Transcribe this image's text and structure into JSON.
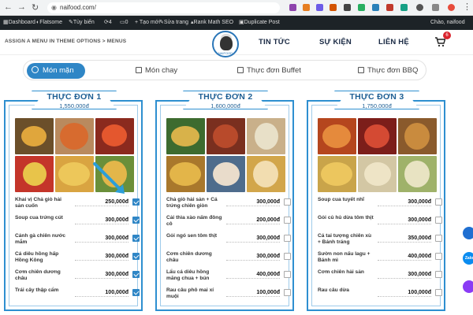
{
  "browser": {
    "url": "naifood.com/",
    "back_icon": "arrow-left-icon",
    "forward_icon": "arrow-right-icon",
    "reload_icon": "reload-icon"
  },
  "admin_bar": {
    "site": "Dashboard",
    "flatsome": "Flatsome",
    "customize": "Tùy biến",
    "updates": "4",
    "comments": "0",
    "new": "+ Tạo mới",
    "edit": "Sửa trang",
    "seo": "Rank Math SEO",
    "duplicate": "Duplicate Post",
    "greeting": "Chào, naifood"
  },
  "header": {
    "breadcrumb": "ASSIGN A MENU IN THEME OPTIONS > MENUS",
    "nav": [
      "TIN TỨC",
      "SỰ KIỆN",
      "LIÊN HỆ"
    ],
    "cart_count": "6",
    "logo_text": "NAIFOOD"
  },
  "tabs": [
    {
      "label": "Món mặn",
      "active": true
    },
    {
      "label": "Món chay",
      "active": false
    },
    {
      "label": "Thực đơn Buffet",
      "active": false
    },
    {
      "label": "Thực đơn BBQ",
      "active": false
    }
  ],
  "menus": [
    {
      "title": "THỰC ĐƠN 1",
      "price": "1,550,000đ",
      "items": [
        {
          "name": "Khai vị Chả giò hải sản cuốn",
          "price": "250,000đ",
          "checked": true
        },
        {
          "name": "Soup cua trứng cút",
          "price": "300,000đ",
          "checked": true
        },
        {
          "name": "Cánh gà chiên nước mắm",
          "price": "300,000đ",
          "checked": true
        },
        {
          "name": "Cá diêu hồng hấp Hồng Kông",
          "price": "300,000đ",
          "checked": true
        },
        {
          "name": "Cơm chiên dương châu",
          "price": "300,000đ",
          "checked": true
        },
        {
          "name": "Trái cây thập cẩm",
          "price": "100,000đ",
          "checked": true
        }
      ]
    },
    {
      "title": "THỰC ĐƠN 2",
      "price": "1,600,000đ",
      "items": [
        {
          "name": "Chả giò hải sản + Cá trứng chiên giòn",
          "price": "300,000đ",
          "checked": false
        },
        {
          "name": "Cải thìa xào nấm đông cô",
          "price": "200,000đ",
          "checked": false
        },
        {
          "name": "Gỏi ngó sen tôm thịt",
          "price": "300,000đ",
          "checked": false
        },
        {
          "name": "Cơm chiên dương châu",
          "price": "300,000đ",
          "checked": false
        },
        {
          "name": "Lẩu cá diêu hồng măng chua + bún",
          "price": "400,000đ",
          "checked": false
        },
        {
          "name": "Rau câu phô mai xí muội",
          "price": "100,000đ",
          "checked": false
        }
      ]
    },
    {
      "title": "THỰC ĐƠN 3",
      "price": "1,750,000đ",
      "items": [
        {
          "name": "Soup cua tuyết nhĩ",
          "price": "300,000đ",
          "checked": false
        },
        {
          "name": "Gỏi củ hủ dừa tôm thịt",
          "price": "300,000đ",
          "checked": false
        },
        {
          "name": "Cá tai tượng chiên xù + Bánh tráng",
          "price": "350,000đ",
          "checked": false
        },
        {
          "name": "Sườn non nấu lagu + Bánh mì",
          "price": "400,000đ",
          "checked": false
        },
        {
          "name": "Cơm chiên hải sản",
          "price": "300,000đ",
          "checked": false
        },
        {
          "name": "Rau câu dừa",
          "price": "100,000đ",
          "checked": false
        }
      ]
    }
  ],
  "float_buttons": [
    "phone-icon",
    "zalo-icon",
    "messenger-icon"
  ],
  "float_labels": {
    "zalo": "Zalo"
  }
}
